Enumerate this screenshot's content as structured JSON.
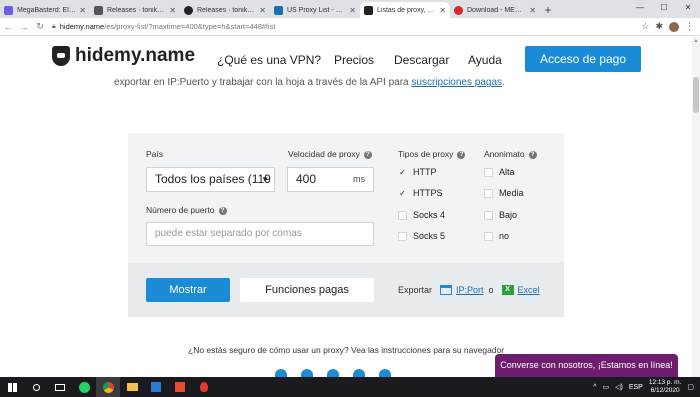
{
  "browser": {
    "tabs": [
      {
        "title": "MegaBasterd: El progr",
        "color": "#6c5ce7",
        "active": false
      },
      {
        "title": "Releases · tonikelope/m",
        "color": "#555",
        "active": false
      },
      {
        "title": "Releases · tonikelope/m",
        "color": "#222",
        "active": false
      },
      {
        "title": "US Proxy List - Free Pro",
        "color": "#1a6fb0",
        "active": false
      },
      {
        "title": "Listas de proxy, una u",
        "color": "#222",
        "active": true
      },
      {
        "title": "Download - MEGA 94%",
        "color": "#d9272e",
        "active": false
      }
    ],
    "new_tab": "+",
    "url_host": "hidemy.name",
    "url_path": "/es/proxy-list/?maxtime=400&type=h&start=448#list"
  },
  "header": {
    "logo": "hidemy.name",
    "nav": [
      "¿Qué es una VPN?",
      "Precios",
      "Descargar",
      "Ayuda"
    ],
    "cta": "Acceso de pago"
  },
  "intro": {
    "text": "exportar en IP:Puerto y trabajar con la hoja a través de la API para ",
    "link": "suscripciones pagas",
    "suffix": "."
  },
  "filters": {
    "country_label": "País",
    "country_value": "Todos los países (119",
    "speed_label": "Velocidad de proxy",
    "speed_value": "400",
    "speed_unit": "ms",
    "port_label": "Número de puerto",
    "port_placeholder": "puede estar separado por comas",
    "types_label": "Tipos de proxy",
    "types": [
      {
        "label": "HTTP",
        "checked": true
      },
      {
        "label": "HTTPS",
        "checked": true
      },
      {
        "label": "Socks 4",
        "checked": false
      },
      {
        "label": "Socks 5",
        "checked": false
      }
    ],
    "anon_label": "Anonimato",
    "anon": [
      {
        "label": "Alta",
        "checked": false
      },
      {
        "label": "Media",
        "checked": false
      },
      {
        "label": "Bajo",
        "checked": false
      },
      {
        "label": "no",
        "checked": false
      }
    ],
    "show_button": "Mostrar",
    "paid_button": "Funciones pagas",
    "export_label": "Exportar",
    "export_ipport": "IP:Port",
    "export_or": "o",
    "export_excel": "Excel"
  },
  "help_text": "¿No estás seguro de cómo usar un proxy? Vea las instrucciones para su navegador",
  "chat": "Converse con nosotros, ¡Estamos en línea!",
  "taskbar": {
    "lang": "ESP",
    "time": "12:13 p. m.",
    "date": "6/12/2020"
  }
}
